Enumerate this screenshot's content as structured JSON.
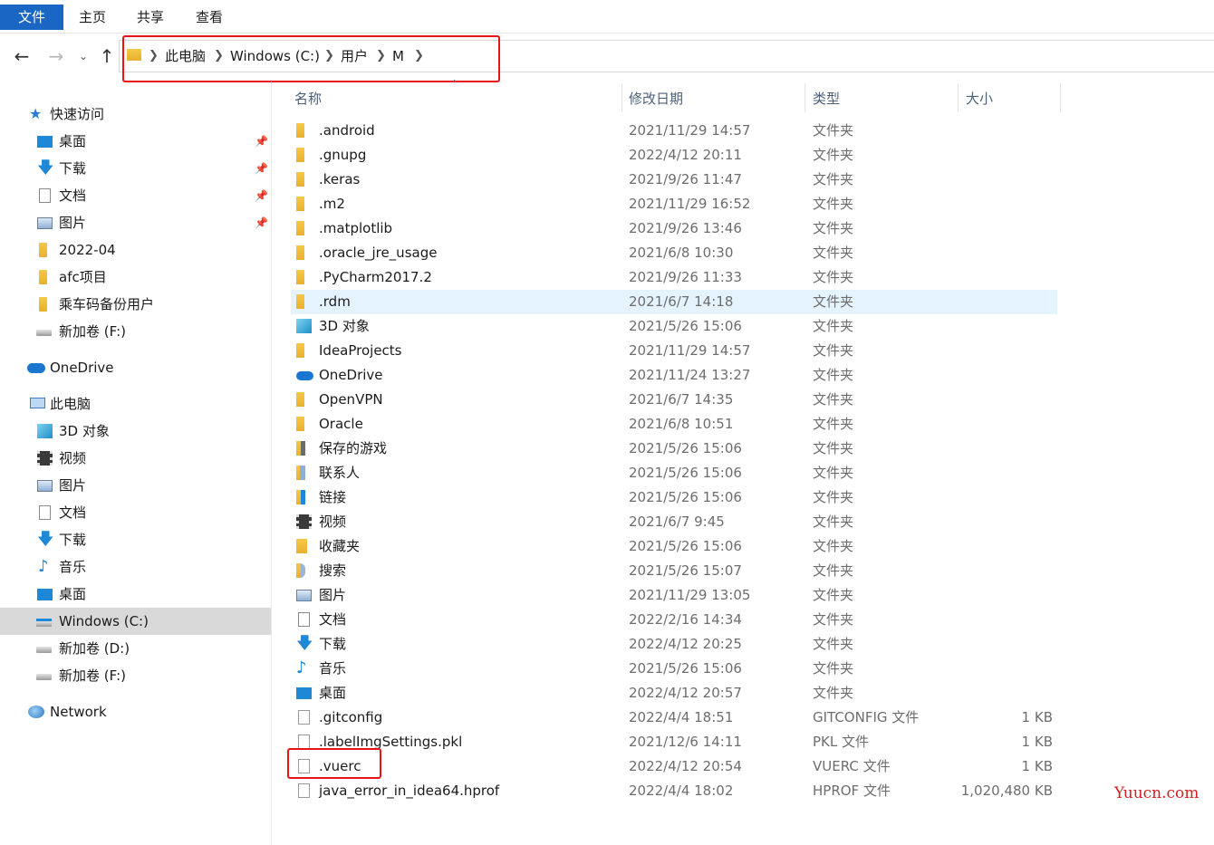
{
  "ribbon": {
    "tabs": [
      "文件",
      "主页",
      "共享",
      "查看"
    ]
  },
  "breadcrumb": [
    "此电脑",
    "Windows (C:)",
    "用户",
    "M"
  ],
  "sidebar": {
    "quick_access": {
      "label": "快速访问",
      "icon": "star-icon"
    },
    "quick_items": [
      {
        "label": "桌面",
        "icon": "desktop-icon",
        "pinned": true
      },
      {
        "label": "下载",
        "icon": "download-icon",
        "pinned": true
      },
      {
        "label": "文档",
        "icon": "document-icon",
        "pinned": true
      },
      {
        "label": "图片",
        "icon": "pictures-icon",
        "pinned": true
      },
      {
        "label": "2022-04",
        "icon": "folder-icon",
        "pinned": false
      },
      {
        "label": "afc项目",
        "icon": "folder-icon",
        "pinned": false
      },
      {
        "label": "乘车码备份用户",
        "icon": "folder-icon",
        "pinned": false
      },
      {
        "label": "新加卷 (F:)",
        "icon": "drive-icon",
        "pinned": false
      }
    ],
    "onedrive": {
      "label": "OneDrive",
      "icon": "cloud-icon"
    },
    "this_pc": {
      "label": "此电脑",
      "icon": "computer-icon"
    },
    "pc_items": [
      {
        "label": "3D 对象",
        "icon": "3d-objects-icon"
      },
      {
        "label": "视频",
        "icon": "video-icon"
      },
      {
        "label": "图片",
        "icon": "pictures-icon"
      },
      {
        "label": "文档",
        "icon": "document-icon"
      },
      {
        "label": "下载",
        "icon": "download-icon"
      },
      {
        "label": "音乐",
        "icon": "music-icon"
      },
      {
        "label": "桌面",
        "icon": "desktop-icon"
      },
      {
        "label": "Windows (C:)",
        "icon": "windows-drive-icon",
        "selected": true
      },
      {
        "label": "新加卷 (D:)",
        "icon": "drive-icon"
      },
      {
        "label": "新加卷 (F:)",
        "icon": "drive-icon"
      }
    ],
    "network": {
      "label": "Network",
      "icon": "network-icon"
    }
  },
  "columns": {
    "name": "名称",
    "date": "修改日期",
    "type": "类型",
    "size": "大小"
  },
  "files": [
    {
      "name": ".android",
      "date": "2021/11/29 14:57",
      "type": "文件夹",
      "size": "",
      "icon": "folder-icon"
    },
    {
      "name": ".gnupg",
      "date": "2022/4/12 20:11",
      "type": "文件夹",
      "size": "",
      "icon": "folder-icon"
    },
    {
      "name": ".keras",
      "date": "2021/9/26 11:47",
      "type": "文件夹",
      "size": "",
      "icon": "folder-icon"
    },
    {
      "name": ".m2",
      "date": "2021/11/29 16:52",
      "type": "文件夹",
      "size": "",
      "icon": "folder-icon"
    },
    {
      "name": ".matplotlib",
      "date": "2021/9/26 13:46",
      "type": "文件夹",
      "size": "",
      "icon": "folder-icon"
    },
    {
      "name": ".oracle_jre_usage",
      "date": "2021/6/8 10:30",
      "type": "文件夹",
      "size": "",
      "icon": "folder-icon"
    },
    {
      "name": ".PyCharm2017.2",
      "date": "2021/9/26 11:33",
      "type": "文件夹",
      "size": "",
      "icon": "folder-icon"
    },
    {
      "name": ".rdm",
      "date": "2021/6/7 14:18",
      "type": "文件夹",
      "size": "",
      "icon": "folder-icon",
      "highlighted": true
    },
    {
      "name": "3D 对象",
      "date": "2021/5/26 15:06",
      "type": "文件夹",
      "size": "",
      "icon": "3d-objects-icon"
    },
    {
      "name": "IdeaProjects",
      "date": "2021/11/29 14:57",
      "type": "文件夹",
      "size": "",
      "icon": "folder-icon"
    },
    {
      "name": "OneDrive",
      "date": "2021/11/24 13:27",
      "type": "文件夹",
      "size": "",
      "icon": "cloud-icon"
    },
    {
      "name": "OpenVPN",
      "date": "2021/6/7 14:35",
      "type": "文件夹",
      "size": "",
      "icon": "folder-icon"
    },
    {
      "name": "Oracle",
      "date": "2021/6/8 10:51",
      "type": "文件夹",
      "size": "",
      "icon": "folder-icon"
    },
    {
      "name": "保存的游戏",
      "date": "2021/5/26 15:06",
      "type": "文件夹",
      "size": "",
      "icon": "saved-games-icon"
    },
    {
      "name": "联系人",
      "date": "2021/5/26 15:06",
      "type": "文件夹",
      "size": "",
      "icon": "contacts-icon"
    },
    {
      "name": "链接",
      "date": "2021/5/26 15:06",
      "type": "文件夹",
      "size": "",
      "icon": "links-icon"
    },
    {
      "name": "视频",
      "date": "2021/6/7 9:45",
      "type": "文件夹",
      "size": "",
      "icon": "video-icon"
    },
    {
      "name": "收藏夹",
      "date": "2021/5/26 15:06",
      "type": "文件夹",
      "size": "",
      "icon": "favorites-icon"
    },
    {
      "name": "搜索",
      "date": "2021/5/26 15:07",
      "type": "文件夹",
      "size": "",
      "icon": "search-folder-icon"
    },
    {
      "name": "图片",
      "date": "2021/11/29 13:05",
      "type": "文件夹",
      "size": "",
      "icon": "pictures-icon"
    },
    {
      "name": "文档",
      "date": "2022/2/16 14:34",
      "type": "文件夹",
      "size": "",
      "icon": "document-icon"
    },
    {
      "name": "下载",
      "date": "2022/4/12 20:25",
      "type": "文件夹",
      "size": "",
      "icon": "download-icon"
    },
    {
      "name": "音乐",
      "date": "2021/5/26 15:06",
      "type": "文件夹",
      "size": "",
      "icon": "music-icon"
    },
    {
      "name": "桌面",
      "date": "2022/4/12 20:57",
      "type": "文件夹",
      "size": "",
      "icon": "desktop-icon"
    },
    {
      "name": ".gitconfig",
      "date": "2022/4/4 18:51",
      "type": "GITCONFIG 文件",
      "size": "1 KB",
      "icon": "file-icon"
    },
    {
      "name": ".labelImgSettings.pkl",
      "date": "2021/12/6 14:11",
      "type": "PKL 文件",
      "size": "1 KB",
      "icon": "file-icon"
    },
    {
      "name": ".vuerc",
      "date": "2022/4/12 20:54",
      "type": "VUERC 文件",
      "size": "1 KB",
      "icon": "file-icon"
    },
    {
      "name": "java_error_in_idea64.hprof",
      "date": "2022/4/4 18:02",
      "type": "HPROF 文件",
      "size": "1,020,480 KB",
      "icon": "file-icon"
    }
  ],
  "watermark": "Yuucn.com",
  "colors": {
    "file_tab": "#1a66c4",
    "annotation": "#e8141a",
    "folder": "#f0bd3c",
    "selection": "#e5f3ff"
  }
}
